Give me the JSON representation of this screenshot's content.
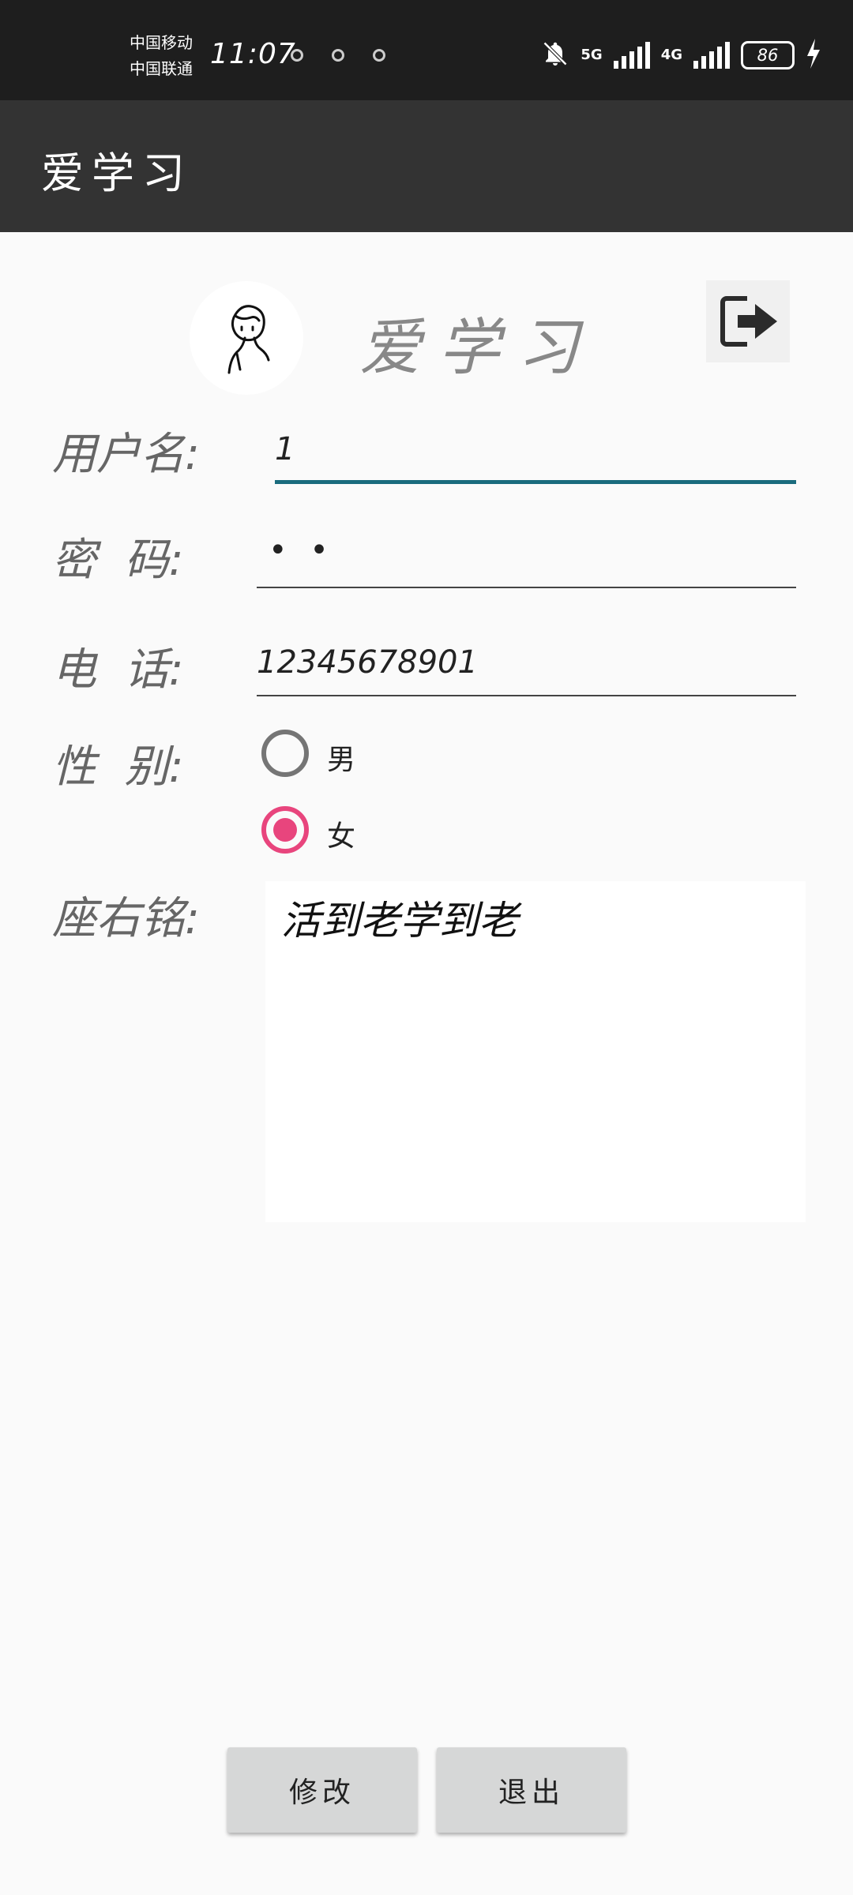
{
  "status_bar": {
    "carrier1": "中国移动",
    "carrier2": "中国联通",
    "time": "11:07",
    "net1": "5G",
    "net2": "4G",
    "battery": "86"
  },
  "app_bar": {
    "title": "爱学习"
  },
  "header": {
    "brand": "爱学习",
    "avatar_icon": "boy-sketch-icon",
    "exit_icon": "exit-icon"
  },
  "form": {
    "username_label": "用户名:",
    "username_value": "1",
    "password_label": "密  码:",
    "password_value": "• •",
    "phone_label": "电  话:",
    "phone_value": "12345678901",
    "gender_label": "性  别:",
    "gender_options": [
      "男",
      "女"
    ],
    "gender_selected": "女",
    "motto_label": "座右铭:",
    "motto_value": "活到老学到老"
  },
  "buttons": {
    "modify": "修改",
    "exit": "退出"
  },
  "colors": {
    "accent": "#e8457d",
    "focus_line": "#1a6b7d",
    "app_bar": "#333333",
    "status_bar": "#1e1e1e"
  }
}
